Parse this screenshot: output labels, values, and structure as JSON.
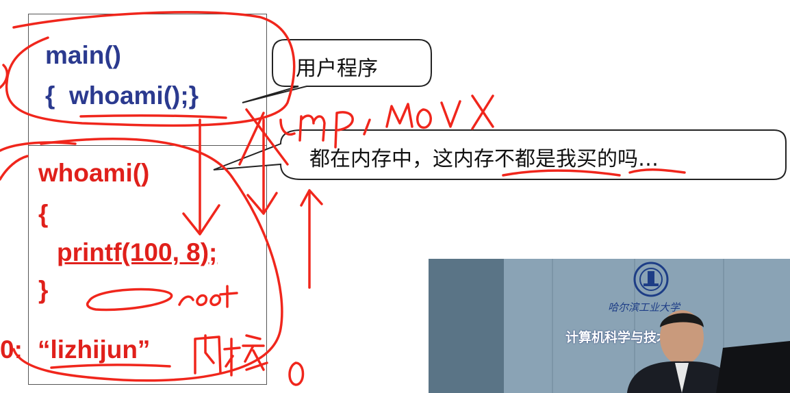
{
  "code_user": {
    "line1": "main()",
    "line2": "{  whoami();}"
  },
  "callout_user": "用户程序",
  "code_kernel": {
    "line1": "whoami()",
    "line2": "{",
    "line3": "printf(100, 8);",
    "line4": "}",
    "line5_prefix": "0:",
    "line5_string": "“lizhijun”"
  },
  "callout_memory": "都在内存中，这内存不都是我买的吗…",
  "handwriting": {
    "jmp_mov": "jmp, mov x",
    "root": "root",
    "kernel": "内核",
    "zero": "0"
  },
  "video": {
    "sign_main": "计算机科学与技术学院",
    "sign_calligraphy": "哈尔滨工业大学"
  },
  "colors": {
    "blue_code": "#2b3a8f",
    "red_code": "#e0201b",
    "annotation": "#f0261c"
  }
}
